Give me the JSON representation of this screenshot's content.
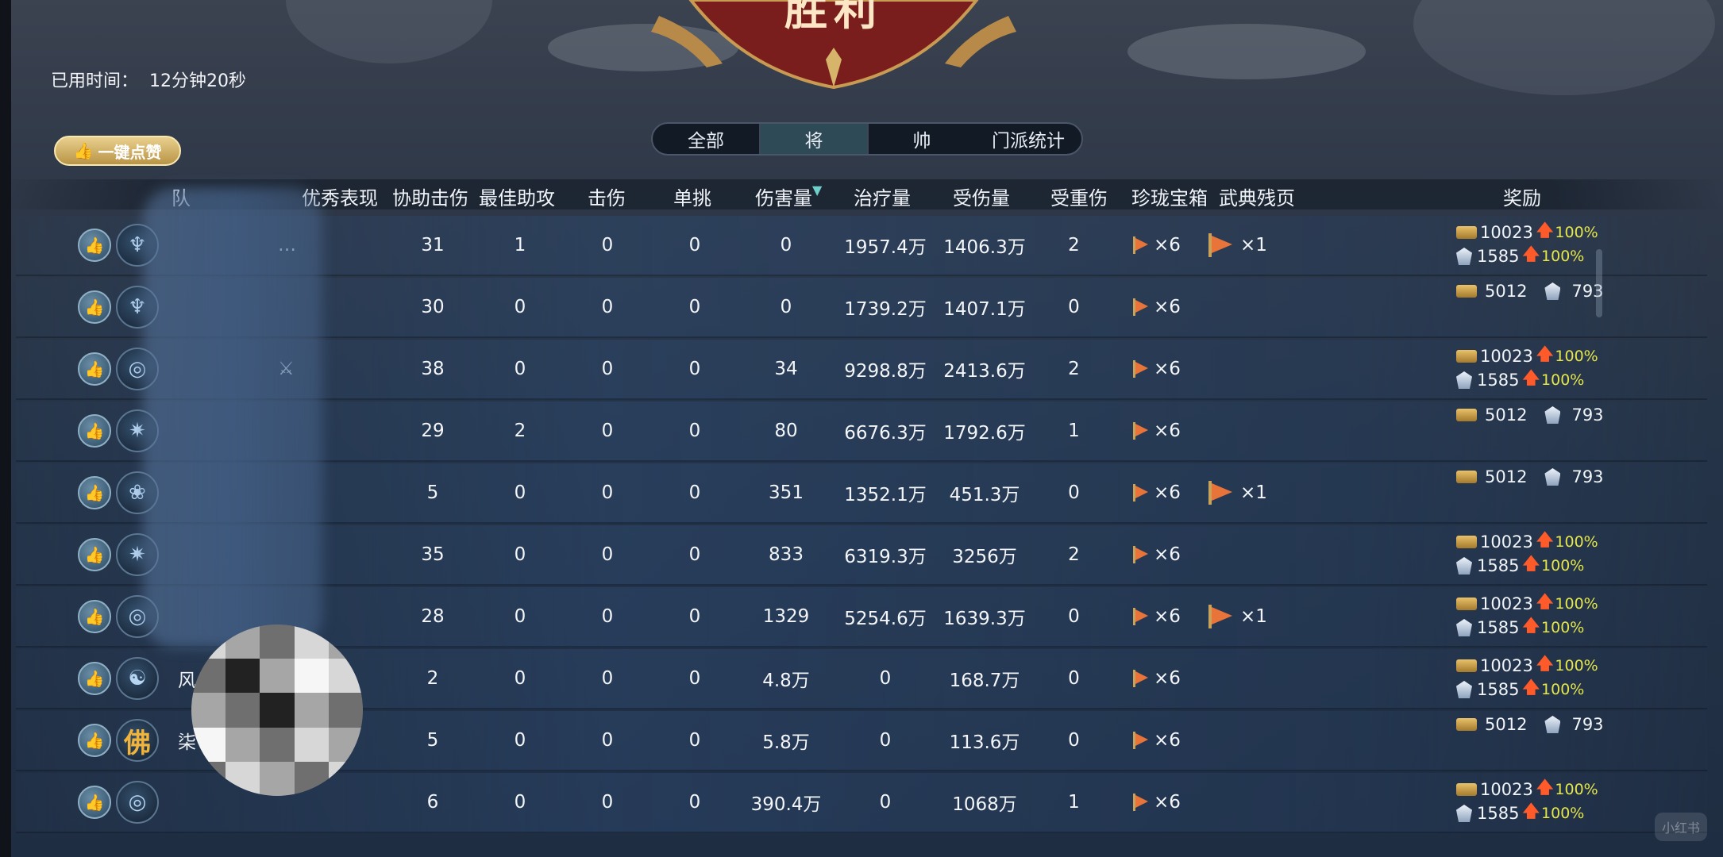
{
  "banner": {
    "title": "胜利"
  },
  "elapsed": {
    "label": "已用时间：",
    "value": "12分钟20秒"
  },
  "like_all": {
    "label": "一键点赞"
  },
  "tabs": [
    {
      "label": "全部",
      "active": false
    },
    {
      "label": "将",
      "active": true
    },
    {
      "label": "帅",
      "active": false
    },
    {
      "label": "门派统计",
      "active": false
    }
  ],
  "columns": [
    "队",
    "优秀表现",
    "协助击伤",
    "最佳助攻",
    "击伤",
    "单挑",
    "伤害量",
    "治疗量",
    "受伤量",
    "受重伤",
    "珍珑宝箱",
    "武典残页",
    "奖励"
  ],
  "players": [
    {
      "avatar": "water",
      "name": "",
      "excellent": "…",
      "assist": "31",
      "best_assist": "1",
      "kills": "0",
      "duel": "0",
      "damage": "0",
      "heal": "1957.4万",
      "taken": "1406.3万",
      "severe": "2",
      "chest": "×6",
      "pages": "×1",
      "reward_boost": true,
      "gold": "10023",
      "silver": "1585",
      "pct1": "100%",
      "pct2": "100%"
    },
    {
      "avatar": "water",
      "name": "",
      "excellent": "",
      "assist": "30",
      "best_assist": "0",
      "kills": "0",
      "duel": "0",
      "damage": "0",
      "heal": "1739.2万",
      "taken": "1407.1万",
      "severe": "0",
      "chest": "×6",
      "pages": "",
      "reward_boost": false,
      "gold": "5012",
      "silver": "793"
    },
    {
      "avatar": "swirl",
      "name": "",
      "excellent": "⚔",
      "assist": "38",
      "best_assist": "0",
      "kills": "0",
      "duel": "0",
      "damage": "34",
      "heal": "9298.8万",
      "taken": "2413.6万",
      "severe": "2",
      "chest": "×6",
      "pages": "",
      "reward_boost": true,
      "gold": "10023",
      "silver": "1585",
      "pct1": "100%",
      "pct2": "100%"
    },
    {
      "avatar": "star",
      "name": "",
      "excellent": "",
      "assist": "29",
      "best_assist": "2",
      "kills": "0",
      "duel": "0",
      "damage": "80",
      "heal": "6676.3万",
      "taken": "1792.6万",
      "severe": "1",
      "chest": "×6",
      "pages": "",
      "reward_boost": false,
      "gold": "5012",
      "silver": "793"
    },
    {
      "avatar": "flower",
      "name": "",
      "excellent": "",
      "assist": "5",
      "best_assist": "0",
      "kills": "0",
      "duel": "0",
      "damage": "351",
      "heal": "1352.1万",
      "taken": "451.3万",
      "severe": "0",
      "chest": "×6",
      "pages": "×1",
      "reward_boost": false,
      "gold": "5012",
      "silver": "793"
    },
    {
      "avatar": "star",
      "name": "",
      "excellent": "",
      "assist": "35",
      "best_assist": "0",
      "kills": "0",
      "duel": "0",
      "damage": "833",
      "heal": "6319.3万",
      "taken": "3256万",
      "severe": "2",
      "chest": "×6",
      "pages": "",
      "reward_boost": true,
      "gold": "10023",
      "silver": "1585",
      "pct1": "100%",
      "pct2": "100%"
    },
    {
      "avatar": "swirl",
      "name": "",
      "excellent": "",
      "assist": "28",
      "best_assist": "0",
      "kills": "0",
      "duel": "0",
      "damage": "1329",
      "heal": "5254.6万",
      "taken": "1639.3万",
      "severe": "0",
      "chest": "×6",
      "pages": "×1",
      "reward_boost": true,
      "gold": "10023",
      "silver": "1585",
      "pct1": "100%",
      "pct2": "100%"
    },
    {
      "avatar": "taiji",
      "name": "风",
      "excellent": "",
      "assist": "2",
      "best_assist": "0",
      "kills": "0",
      "duel": "0",
      "damage": "4.8万",
      "heal": "0",
      "taken": "168.7万",
      "severe": "0",
      "chest": "×6",
      "pages": "",
      "reward_boost": true,
      "gold": "10023",
      "silver": "1585",
      "pct1": "100%",
      "pct2": "100%"
    },
    {
      "avatar": "buddha",
      "avatar_text": "佛",
      "name": "柒",
      "excellent": "",
      "assist": "5",
      "best_assist": "0",
      "kills": "0",
      "duel": "0",
      "damage": "5.8万",
      "heal": "0",
      "taken": "113.6万",
      "severe": "0",
      "chest": "×6",
      "pages": "",
      "reward_boost": false,
      "gold": "5012",
      "silver": "793"
    },
    {
      "avatar": "swirl",
      "name": "",
      "excellent": "",
      "assist": "6",
      "best_assist": "0",
      "kills": "0",
      "duel": "0",
      "damage": "390.4万",
      "heal": "0",
      "taken": "1068万",
      "severe": "1",
      "chest": "×6",
      "pages": "",
      "reward_boost": true,
      "gold": "10023",
      "silver": "1585",
      "pct1": "100%",
      "pct2": "100%"
    }
  ],
  "watermark": "小红书",
  "colors": {
    "accent_teal": "#2f4a57",
    "gold_button": "#d1b064",
    "up_arrow": "#ff5a2a",
    "pct_yellow": "#e4e64a"
  }
}
